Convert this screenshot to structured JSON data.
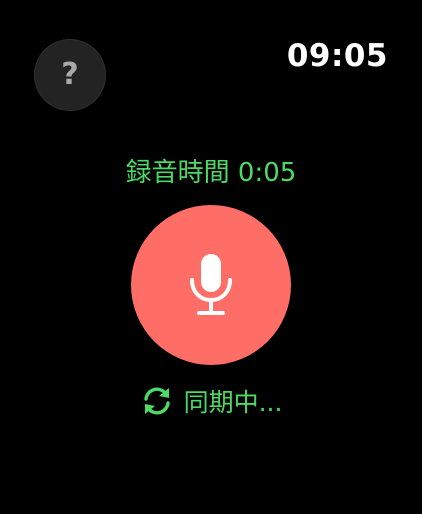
{
  "status_bar": {
    "time": "09:05"
  },
  "help_button": {
    "icon": "question-mark-icon",
    "glyph": "?"
  },
  "recording": {
    "time_label": "録音時間 0:05"
  },
  "mic_button": {
    "icon": "microphone-icon"
  },
  "sync": {
    "icon": "sync-icon",
    "label": "同期中..."
  },
  "colors": {
    "background": "#000000",
    "accent_green": "#4cd964",
    "record_red": "#ff6e66",
    "help_bg": "#232323",
    "help_glyph": "#a9a9a9",
    "clock_text": "#ffffff"
  }
}
